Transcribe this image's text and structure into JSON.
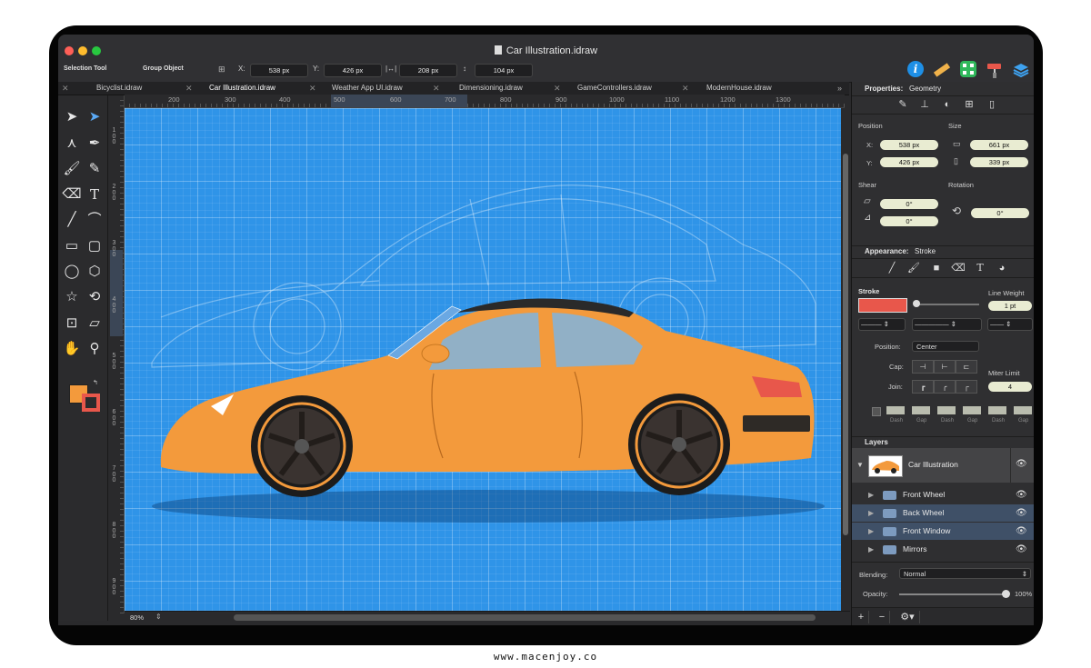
{
  "window": {
    "title": "Car Illustration.idraw"
  },
  "toolbar": {
    "selection_tool_label": "Selection Tool",
    "group_object_label": "Group Object",
    "x_label": "X:",
    "x_value": "538 px",
    "y_label": "Y:",
    "y_value": "426 px",
    "w_value": "208 px",
    "h_value": "104 px"
  },
  "tabs": [
    {
      "label": "Bicyclist.idraw"
    },
    {
      "label": "Car Illustration.idraw"
    },
    {
      "label": "Weather App UI.idraw"
    },
    {
      "label": "Dimensioning.idraw"
    },
    {
      "label": "GameControllers.idraw"
    },
    {
      "label": "ModernHouse.idraw"
    }
  ],
  "ruler": {
    "h": [
      "200",
      "300",
      "400",
      "500",
      "600",
      "700",
      "800",
      "900",
      "1000",
      "1100",
      "1200",
      "1300"
    ],
    "v": [
      "100",
      "200",
      "300",
      "400",
      "500",
      "600",
      "700",
      "800",
      "900"
    ]
  },
  "status": {
    "zoom": "80%"
  },
  "properties": {
    "header_label": "Properties:",
    "header_value": "Geometry",
    "position_label": "Position",
    "size_label": "Size",
    "x_label": "X:",
    "x_value": "538 px",
    "y_label": "Y:",
    "y_value": "426 px",
    "width_value": "661 px",
    "height_value": "339 px",
    "shear_label": "Shear",
    "rotation_label": "Rotation",
    "shear_h": "0°",
    "shear_v": "0°",
    "rotation_value": "0°"
  },
  "appearance": {
    "header_label": "Appearance:",
    "header_value": "Stroke",
    "stroke_label": "Stroke",
    "stroke_color": "#e8574b",
    "line_weight_label": "Line Weight",
    "line_weight_value": "1 pt",
    "position_label": "Position:",
    "position_value": "Center",
    "cap_label": "Cap:",
    "join_label": "Join:",
    "miter_label": "Miter Limit",
    "miter_value": "4",
    "dash_labels": [
      "Dash",
      "Gap",
      "Dash",
      "Gap",
      "Dash",
      "Gap"
    ]
  },
  "layers": {
    "header": "Layers",
    "group": "Car Illustration",
    "items": [
      {
        "name": "Front Wheel",
        "selected": false
      },
      {
        "name": "Back Wheel",
        "selected": true
      },
      {
        "name": "Front Window",
        "selected": true
      },
      {
        "name": "Mirrors",
        "selected": false
      }
    ],
    "blending_label": "Blending:",
    "blending_value": "Normal",
    "opacity_label": "Opacity:",
    "opacity_value": "100%"
  },
  "colors": {
    "canvas": "#2f94e8",
    "car_body": "#f39a3c",
    "selection": "#3f5067",
    "accent_blue": "#1e8fe6"
  },
  "watermark": "www.macenjoy.co"
}
